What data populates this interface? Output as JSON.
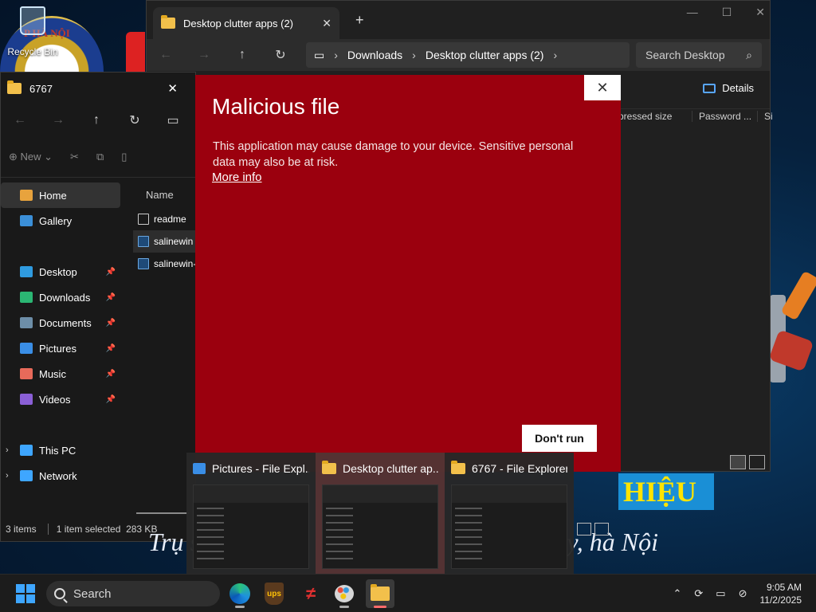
{
  "desktop": {
    "recycle_bin_label": "Recycle Bin",
    "logo_text": "P HÀ NỘI",
    "banner_text": "HIỆU",
    "slogan_left": "Trụ s",
    "slogan_right": "y, hà Nội"
  },
  "window_back": {
    "tab_title": "Desktop clutter apps (2)",
    "breadcrumb": [
      "Downloads",
      "Desktop clutter apps (2)"
    ],
    "search_placeholder": "Search Desktop",
    "details_label": "Details",
    "columns": [
      "pressed size",
      "Password ...",
      "Si"
    ]
  },
  "window_front": {
    "title": "6767",
    "new_label": "New",
    "sidebar": [
      {
        "label": "Home",
        "icon": "home-icon",
        "color": "#e8a33d",
        "pinned": false
      },
      {
        "label": "Gallery",
        "icon": "gallery-icon",
        "color": "#3b8fd8",
        "pinned": false
      },
      {
        "label": "Desktop",
        "icon": "desktop-icon",
        "color": "#2f9be0",
        "pinned": true
      },
      {
        "label": "Downloads",
        "icon": "downloads-icon",
        "color": "#2bb673",
        "pinned": true
      },
      {
        "label": "Documents",
        "icon": "documents-icon",
        "color": "#6d8ea8",
        "pinned": true
      },
      {
        "label": "Pictures",
        "icon": "pictures-icon",
        "color": "#3a8ee6",
        "pinned": true
      },
      {
        "label": "Music",
        "icon": "music-icon",
        "color": "#e86a5a",
        "pinned": true
      },
      {
        "label": "Videos",
        "icon": "videos-icon",
        "color": "#8a5fd6",
        "pinned": true
      },
      {
        "label": "This PC",
        "icon": "this-pc-icon",
        "color": "#3ea6ff",
        "pinned": false
      },
      {
        "label": "Network",
        "icon": "network-icon",
        "color": "#3ea6ff",
        "pinned": false
      }
    ],
    "name_header": "Name",
    "files": [
      {
        "name": "readme",
        "type": "text"
      },
      {
        "name": "salinewin",
        "type": "exe"
      },
      {
        "name": "salinewin-l",
        "type": "exe"
      }
    ],
    "status": {
      "items": "3 items",
      "selected": "1 item selected",
      "size": "283 KB"
    }
  },
  "dialog": {
    "title": "Malicious file",
    "body": "This application may cause damage to your device. Sensitive personal data may also be at risk.",
    "link": "More info",
    "button": "Don't run",
    "close": "✕"
  },
  "previews": [
    {
      "title": "Pictures - File Expl...",
      "icon": "pictures-icon"
    },
    {
      "title": "Desktop clutter ap...",
      "icon": "folder-icon"
    },
    {
      "title": "6767 - File Explorer",
      "icon": "folder-icon"
    }
  ],
  "taskbar": {
    "search_label": "Search",
    "apps": [
      "edge",
      "ups",
      "flashget",
      "paint",
      "file-explorer"
    ],
    "ups_text": "ups",
    "time": "9:05 AM",
    "date": "11/2/2025"
  },
  "colors": {
    "dialog_bg": "#9b000e",
    "accent": "#3ea6ff"
  }
}
